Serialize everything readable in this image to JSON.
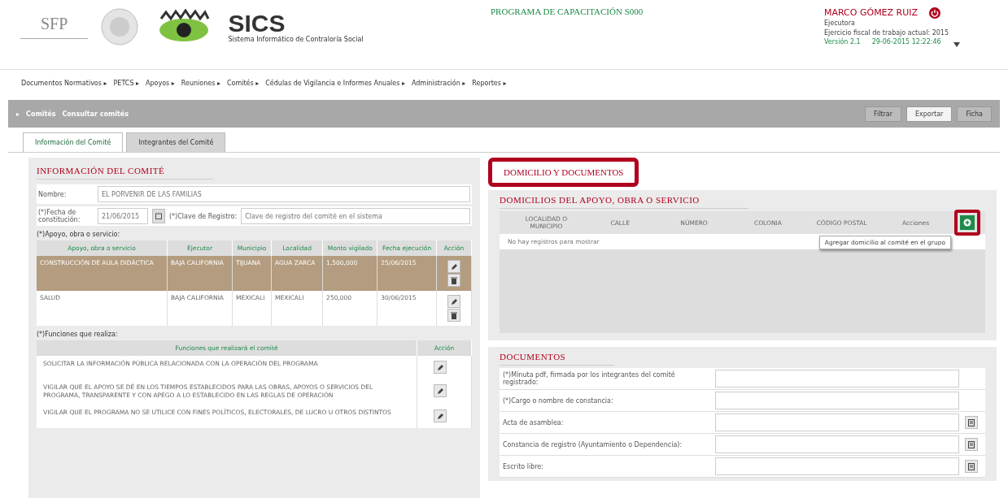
{
  "header": {
    "agency": "SFP",
    "app_name": "SICS",
    "app_subtitle": "Sistema Informático de Contraloría Social",
    "program_title": "PROGRAMA DE CAPACITACIÓN S000",
    "user": {
      "name": "MARCO GÓMEZ RUIZ",
      "role": "Ejecutora",
      "fiscal_year": "Ejercicio fiscal de trabajo actual: 2015",
      "version": "Versión 2.1",
      "timestamp": "29-06-2015 12:22:46"
    }
  },
  "menu": [
    "Documentos Normativos ▸",
    "PETCS ▸",
    "Apoyos ▸",
    "Reuniones ▸",
    "Comités ▸",
    "Cédulas de Vigilancia e Informes Anuales ▸",
    "Administración ▸",
    "Reportes ▸"
  ],
  "breadcrumb_icon": "▸",
  "breadcrumb": [
    "Comités",
    "Consultar comités"
  ],
  "toolbar": [
    "Filtrar",
    "Exportar",
    "Ficha"
  ],
  "tabs": [
    {
      "label": "Información del Comité",
      "selected": true
    },
    {
      "label": "Integrantes del Comité",
      "selected": false
    }
  ],
  "committee": {
    "title": "INFORMACIÓN DEL COMITÉ",
    "name_label": "Nombre:",
    "name_value": "EL PORVENIR DE LAS FAMILIAS",
    "date_label": "(*)Fecha de constitución:",
    "date_value": "21/06/2015",
    "registry_label": "(*)Clave de Registro:",
    "registry_placeholder": "Clave de registro del comité en el sistema",
    "apoyos_label": "(*)Apoyo, obra o servicio:",
    "apoyos_columns": [
      "Apoyo, obra o servicio",
      "Ejecutor",
      "Municipio",
      "Localidad",
      "Monto vigilado",
      "Fecha ejecución",
      "Acción"
    ],
    "apoyos_rows": [
      {
        "selected": true,
        "cells": [
          "CONSTRUCCIÓN DE AULA DIDÁCTICA",
          "BAJA CALIFORNIA",
          "TIJUANA",
          "AGUA ZARCA",
          "1,500,000",
          "25/06/2015"
        ]
      },
      {
        "selected": false,
        "cells": [
          "SALUD",
          "BAJA CALIFORNIA",
          "MEXICALI",
          "MEXICALI",
          "250,000",
          "30/06/2015"
        ]
      }
    ],
    "funciones_label": "(*)Funciones que realiza:",
    "funciones_columns": [
      "Funciones que realizará el comité",
      "Acción"
    ],
    "funciones_rows": [
      "SOLICITAR LA INFORMACIÓN PÚBLICA RELACIONADA CON LA OPERACIÓN DEL PROGRAMA",
      "VIGILAR QUE EL APOYO SE DÉ EN LOS TIEMPOS ESTABLECIDOS PARA LAS OBRAS, APOYOS O SERVICIOS DEL PROGRAMA, TRANSPARENTE Y CON APEGO A LO ESTABLECIDO EN LAS REGLAS DE OPERACIÓN",
      "VIGILAR QUE EL PROGRAMA NO SE UTILICE CON FINES POLÍTICOS, ELECTORALES, DE LUCRO U OTROS DISTINTOS"
    ]
  },
  "domicilio": {
    "tab_title": "DOMICILIO Y DOCUMENTOS",
    "highlighted": true,
    "title": "DOMICILIOS DEL APOYO, OBRA O SERVICIO",
    "columns": [
      "LOCALIDAD O MUNICIPIO",
      "CALLE",
      "NÚMERO",
      "COLONIA",
      "CÓDIGO POSTAL",
      "Acciones"
    ],
    "add_highlighted": true,
    "empty_text": "No hay registros para mostrar",
    "tooltip": "Agregar domicilio al comité en el grupo"
  },
  "documents": {
    "title": "DOCUMENTOS",
    "rows": [
      {
        "label": "(*)Minuta pdf, firmada por los integrantes del comité registrado:",
        "has_button": false
      },
      {
        "label": "(*)Cargo o nombre de constancia:",
        "has_button": false
      },
      {
        "label": "Acta de asamblea:",
        "has_button": true
      },
      {
        "label": "Constancia de registro (Ayuntamiento o Dependencia):",
        "has_button": true
      },
      {
        "label": "Escrito libre:",
        "has_button": true
      }
    ]
  }
}
